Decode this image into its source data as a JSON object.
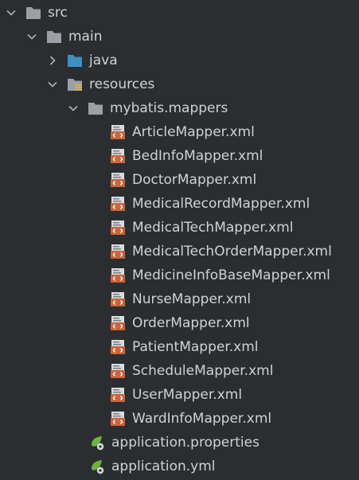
{
  "colors": {
    "background": "#2b2d30",
    "text": "#d0d2d6",
    "folder": "#9aa0a6",
    "source_folder": "#3f8fc3",
    "xml_icon": "#c8663c",
    "spring_icon": "#6db33f"
  },
  "tree": {
    "src": {
      "label": "src",
      "expanded": true,
      "icon": "folder-icon"
    },
    "main": {
      "label": "main",
      "expanded": true,
      "icon": "folder-icon"
    },
    "java": {
      "label": "java",
      "expanded": false,
      "icon": "source-folder-icon"
    },
    "resources": {
      "label": "resources",
      "expanded": true,
      "icon": "resources-folder-icon"
    },
    "mybatis_mappers": {
      "label": "mybatis.mappers",
      "expanded": true,
      "icon": "package-folder-icon"
    },
    "xml_files": [
      {
        "label": "ArticleMapper.xml",
        "icon": "xml-file-icon"
      },
      {
        "label": "BedInfoMapper.xml",
        "icon": "xml-file-icon"
      },
      {
        "label": "DoctorMapper.xml",
        "icon": "xml-file-icon"
      },
      {
        "label": "MedicalRecordMapper.xml",
        "icon": "xml-file-icon"
      },
      {
        "label": "MedicalTechMapper.xml",
        "icon": "xml-file-icon"
      },
      {
        "label": "MedicalTechOrderMapper.xml",
        "icon": "xml-file-icon"
      },
      {
        "label": "MedicineInfoBaseMapper.xml",
        "icon": "xml-file-icon"
      },
      {
        "label": "NurseMapper.xml",
        "icon": "xml-file-icon"
      },
      {
        "label": "OrderMapper.xml",
        "icon": "xml-file-icon"
      },
      {
        "label": "PatientMapper.xml",
        "icon": "xml-file-icon"
      },
      {
        "label": "ScheduleMapper.xml",
        "icon": "xml-file-icon"
      },
      {
        "label": "UserMapper.xml",
        "icon": "xml-file-icon"
      },
      {
        "label": "WardInfoMapper.xml",
        "icon": "xml-file-icon"
      }
    ],
    "config_files": [
      {
        "label": "application.properties",
        "icon": "spring-config-icon"
      },
      {
        "label": "application.yml",
        "icon": "spring-config-icon"
      }
    ]
  }
}
